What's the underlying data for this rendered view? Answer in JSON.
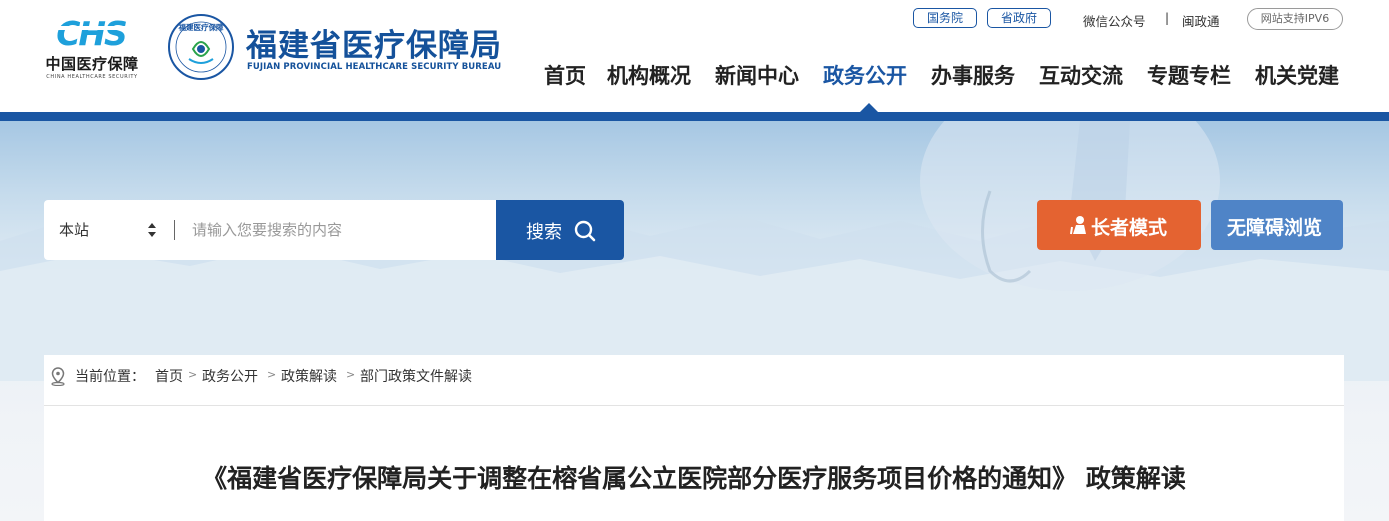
{
  "brand": {
    "chs_mark": "CHS",
    "chs_cn": "中国医疗保障",
    "chs_en": "CHINA HEALTHCARE SECURITY",
    "seal_text": "福建医疗保障",
    "bureau_cn": "福建省医疗保障局",
    "bureau_en": "FUJIAN PROVINCIAL HEALTHCARE SECURITY BUREAU"
  },
  "toplinks": {
    "state_council": "国务院",
    "provincial_gov": "省政府",
    "wechat": "微信公众号",
    "separator": "|",
    "mintong": "闽政通",
    "ipv6": "网站支持IPV6"
  },
  "nav": {
    "items": [
      {
        "label": "首页"
      },
      {
        "label": "机构概况"
      },
      {
        "label": "新闻中心"
      },
      {
        "label": "政务公开",
        "active": true
      },
      {
        "label": "办事服务"
      },
      {
        "label": "互动交流"
      },
      {
        "label": "专题专栏"
      },
      {
        "label": "机关党建"
      }
    ]
  },
  "search": {
    "scope": "本站",
    "placeholder": "请输入您要搜索的内容",
    "button_label": "搜索"
  },
  "modes": {
    "elder": "长者模式",
    "accessible": "无障碍浏览"
  },
  "breadcrumb": {
    "prefix": "当前位置：",
    "items": [
      "首页",
      "政务公开",
      "政策解读",
      "部门政策文件解读"
    ]
  },
  "article": {
    "title": "《福建省医疗保障局关于调整在榕省属公立医院部分医疗服务项目价格的通知》 政策解读"
  },
  "colors": {
    "brand_blue": "#1a56a3",
    "elder_orange": "#e46331",
    "access_blue": "#4f84c7",
    "chs_cyan": "#1ea0db"
  },
  "icons": [
    "chs-logo-icon",
    "seal-icon",
    "sort-arrows-icon",
    "search-icon",
    "elder-person-icon",
    "location-pin-icon",
    "chevron-right-icon"
  ]
}
